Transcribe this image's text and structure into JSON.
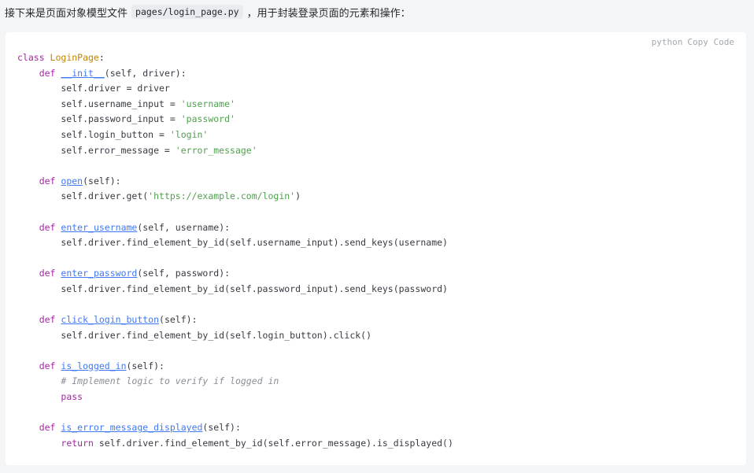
{
  "intro": {
    "before": "接下来是页面对象模型文件",
    "filename": "pages/login_page.py",
    "after": "，用于封装登录页面的元素和操作："
  },
  "code_block": {
    "language": "python",
    "copy_label": "Copy",
    "code_label": "Code",
    "lines": [
      [
        {
          "t": "kw",
          "v": "class "
        },
        {
          "t": "cls",
          "v": "LoginPage"
        },
        {
          "t": "",
          "v": ":"
        }
      ],
      [
        {
          "t": "",
          "v": "    "
        },
        {
          "t": "kw",
          "v": "def "
        },
        {
          "t": "fn",
          "v": "__init__"
        },
        {
          "t": "",
          "v": "(self, driver):"
        }
      ],
      [
        {
          "t": "",
          "v": "        self.driver = driver"
        }
      ],
      [
        {
          "t": "",
          "v": "        self.username_input = "
        },
        {
          "t": "str",
          "v": "'username'"
        }
      ],
      [
        {
          "t": "",
          "v": "        self.password_input = "
        },
        {
          "t": "str",
          "v": "'password'"
        }
      ],
      [
        {
          "t": "",
          "v": "        self.login_button = "
        },
        {
          "t": "str",
          "v": "'login'"
        }
      ],
      [
        {
          "t": "",
          "v": "        self.error_message = "
        },
        {
          "t": "str",
          "v": "'error_message'"
        }
      ],
      [],
      [
        {
          "t": "",
          "v": "    "
        },
        {
          "t": "kw",
          "v": "def "
        },
        {
          "t": "fn",
          "v": "open"
        },
        {
          "t": "",
          "v": "(self):"
        }
      ],
      [
        {
          "t": "",
          "v": "        self.driver.get("
        },
        {
          "t": "str",
          "v": "'https://example.com/login'"
        },
        {
          "t": "",
          "v": ")"
        }
      ],
      [],
      [
        {
          "t": "",
          "v": "    "
        },
        {
          "t": "kw",
          "v": "def "
        },
        {
          "t": "fn",
          "v": "enter_username"
        },
        {
          "t": "",
          "v": "(self, username):"
        }
      ],
      [
        {
          "t": "",
          "v": "        self.driver.find_element_by_id(self.username_input).send_keys(username)"
        }
      ],
      [],
      [
        {
          "t": "",
          "v": "    "
        },
        {
          "t": "kw",
          "v": "def "
        },
        {
          "t": "fn",
          "v": "enter_password"
        },
        {
          "t": "",
          "v": "(self, password):"
        }
      ],
      [
        {
          "t": "",
          "v": "        self.driver.find_element_by_id(self.password_input).send_keys(password)"
        }
      ],
      [],
      [
        {
          "t": "",
          "v": "    "
        },
        {
          "t": "kw",
          "v": "def "
        },
        {
          "t": "fn",
          "v": "click_login_button"
        },
        {
          "t": "",
          "v": "(self):"
        }
      ],
      [
        {
          "t": "",
          "v": "        self.driver.find_element_by_id(self.login_button).click()"
        }
      ],
      [],
      [
        {
          "t": "",
          "v": "    "
        },
        {
          "t": "kw",
          "v": "def "
        },
        {
          "t": "fn",
          "v": "is_logged_in"
        },
        {
          "t": "",
          "v": "(self):"
        }
      ],
      [
        {
          "t": "",
          "v": "        "
        },
        {
          "t": "cm",
          "v": "# Implement logic to verify if logged in"
        }
      ],
      [
        {
          "t": "",
          "v": "        "
        },
        {
          "t": "kw",
          "v": "pass"
        }
      ],
      [],
      [
        {
          "t": "",
          "v": "    "
        },
        {
          "t": "kw",
          "v": "def "
        },
        {
          "t": "fn",
          "v": "is_error_message_displayed"
        },
        {
          "t": "",
          "v": "(self):"
        }
      ],
      [
        {
          "t": "",
          "v": "        "
        },
        {
          "t": "kw",
          "v": "return "
        },
        {
          "t": "",
          "v": "self.driver.find_element_by_id(self.error_message).is_displayed()"
        }
      ]
    ]
  }
}
